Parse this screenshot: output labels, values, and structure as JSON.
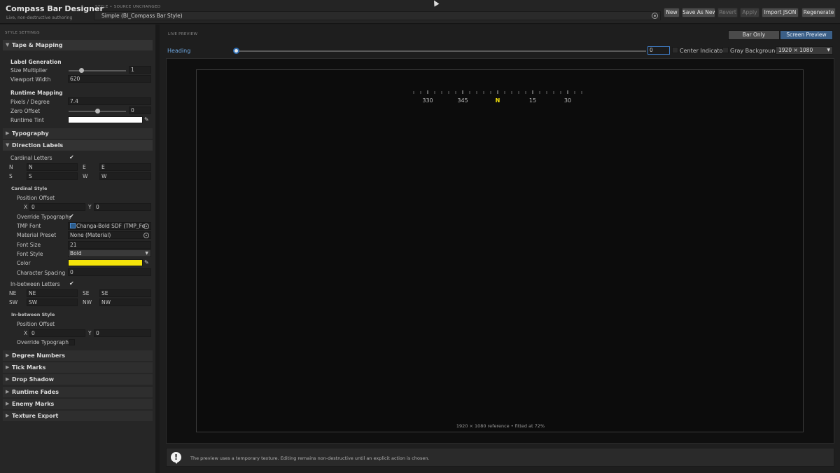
{
  "header": {
    "app_title": "Compass Bar Designer",
    "app_subtitle": "Live, non-destructive authoring",
    "style_caption": "STYLE  •  SOURCE UNCHANGED",
    "style_value": "Simple (BI_Compass Bar Style)",
    "buttons": {
      "new": "New",
      "save_as_new": "Save As New",
      "revert": "Revert",
      "apply": "Apply",
      "import_json": "Import JSON",
      "regenerate": "Regenerate"
    }
  },
  "left": {
    "caption": "STYLE SETTINGS",
    "tape": {
      "title": "Tape & Mapping",
      "label_generation": "Label Generation",
      "size_multiplier_label": "Size Multiplier",
      "size_multiplier_value": "1",
      "size_multiplier_fraction": 0.22,
      "viewport_width_label": "Viewport Width",
      "viewport_width_value": "620",
      "runtime_mapping": "Runtime Mapping",
      "pixels_per_degree_label": "Pixels / Degree",
      "pixels_per_degree_value": "7.4",
      "zero_offset_label": "Zero Offset",
      "zero_offset_value": "0",
      "zero_offset_fraction": 0.5,
      "runtime_tint_label": "Runtime Tint",
      "runtime_tint_color": "#ffffff"
    },
    "typography": {
      "title": "Typography"
    },
    "direction": {
      "title": "Direction Labels",
      "cardinal_letters_label": "Cardinal Letters",
      "n_key": "N",
      "n_value": "N",
      "e_key": "E",
      "e_value": "E",
      "s_key": "S",
      "s_value": "S",
      "w_key": "W",
      "w_value": "W",
      "cardinal_style": "Cardinal Style",
      "position_offset_label": "Position Offset",
      "x_key": "X",
      "x_value": "0",
      "y_key": "Y",
      "y_value": "0",
      "override_typography_label": "Override Typography",
      "tmp_font_label": "TMP Font",
      "tmp_font_value": "Changa-Bold SDF (TMP_Fo",
      "material_preset_label": "Material Preset",
      "material_preset_value": "None (Material)",
      "font_size_label": "Font Size",
      "font_size_value": "21",
      "font_style_label": "Font Style",
      "font_style_value": "Bold",
      "color_label": "Color",
      "color_value": "#f5e40a",
      "character_spacing_label": "Character Spacing",
      "character_spacing_value": "0",
      "inbetween_letters_label": "In-between Letters",
      "ne_key": "NE",
      "ne_value": "NE",
      "se_key": "SE",
      "se_value": "SE",
      "sw_key": "SW",
      "sw_value": "SW",
      "nw_key": "NW",
      "nw_value": "NW",
      "inbetween_style": "In-between Style",
      "ib_position_offset_label": "Position Offset",
      "ib_x_value": "0",
      "ib_y_value": "0",
      "ib_override_typography_label": "Override Typography"
    },
    "collapsed_sections": [
      "Degree Numbers",
      "Tick Marks",
      "Drop Shadow",
      "Runtime Fades",
      "Enemy Marks",
      "Texture Export"
    ]
  },
  "right": {
    "caption": "LIVE PREVIEW",
    "bar_only": "Bar Only",
    "screen_preview": "Screen Preview",
    "heading_label": "Heading",
    "heading_value": "0",
    "center_indicator_label": "Center Indicator",
    "gray_background_label": "Gray Background",
    "resolution_value": "1920 × 1080",
    "compass_labels": [
      "330",
      "345",
      "N",
      "15",
      "30"
    ],
    "compass_highlight_color": "#f5e40a",
    "reference_caption": "1920 × 1080 reference  •  fitted at 72%",
    "info_text": "The preview uses a temporary texture. Editing remains non-destructive until an explicit action is chosen."
  }
}
